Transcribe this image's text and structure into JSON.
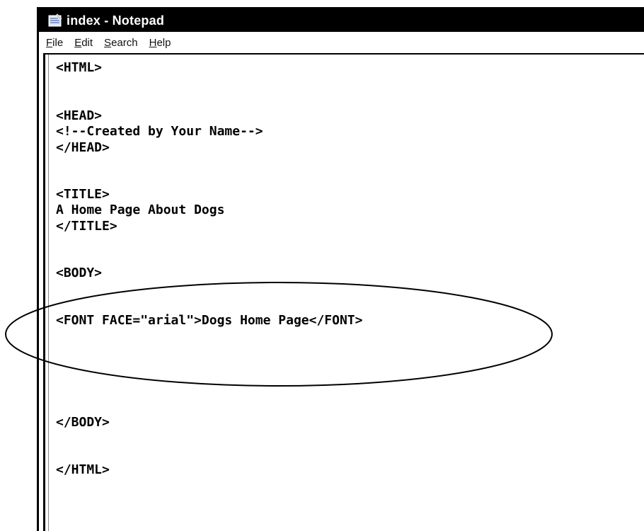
{
  "window": {
    "title": "index - Notepad"
  },
  "menubar": {
    "items": [
      {
        "label": "File"
      },
      {
        "label": "Edit"
      },
      {
        "label": "Search"
      },
      {
        "label": "Help"
      }
    ]
  },
  "editor": {
    "lines": [
      "<HTML>",
      "<HEAD>",
      "<!--Created by Your Name-->",
      "</HEAD>",
      "<TITLE>",
      "A Home Page About Dogs",
      "</TITLE>",
      "<BODY>",
      "<FONT FACE=\"arial\">Dogs Home Page</FONT>",
      "</BODY>",
      "</HTML>"
    ]
  },
  "annotation": {
    "shape": "ellipse",
    "highlighted_line": "<FONT FACE=\"arial\">Dogs Home Page</FONT>"
  }
}
